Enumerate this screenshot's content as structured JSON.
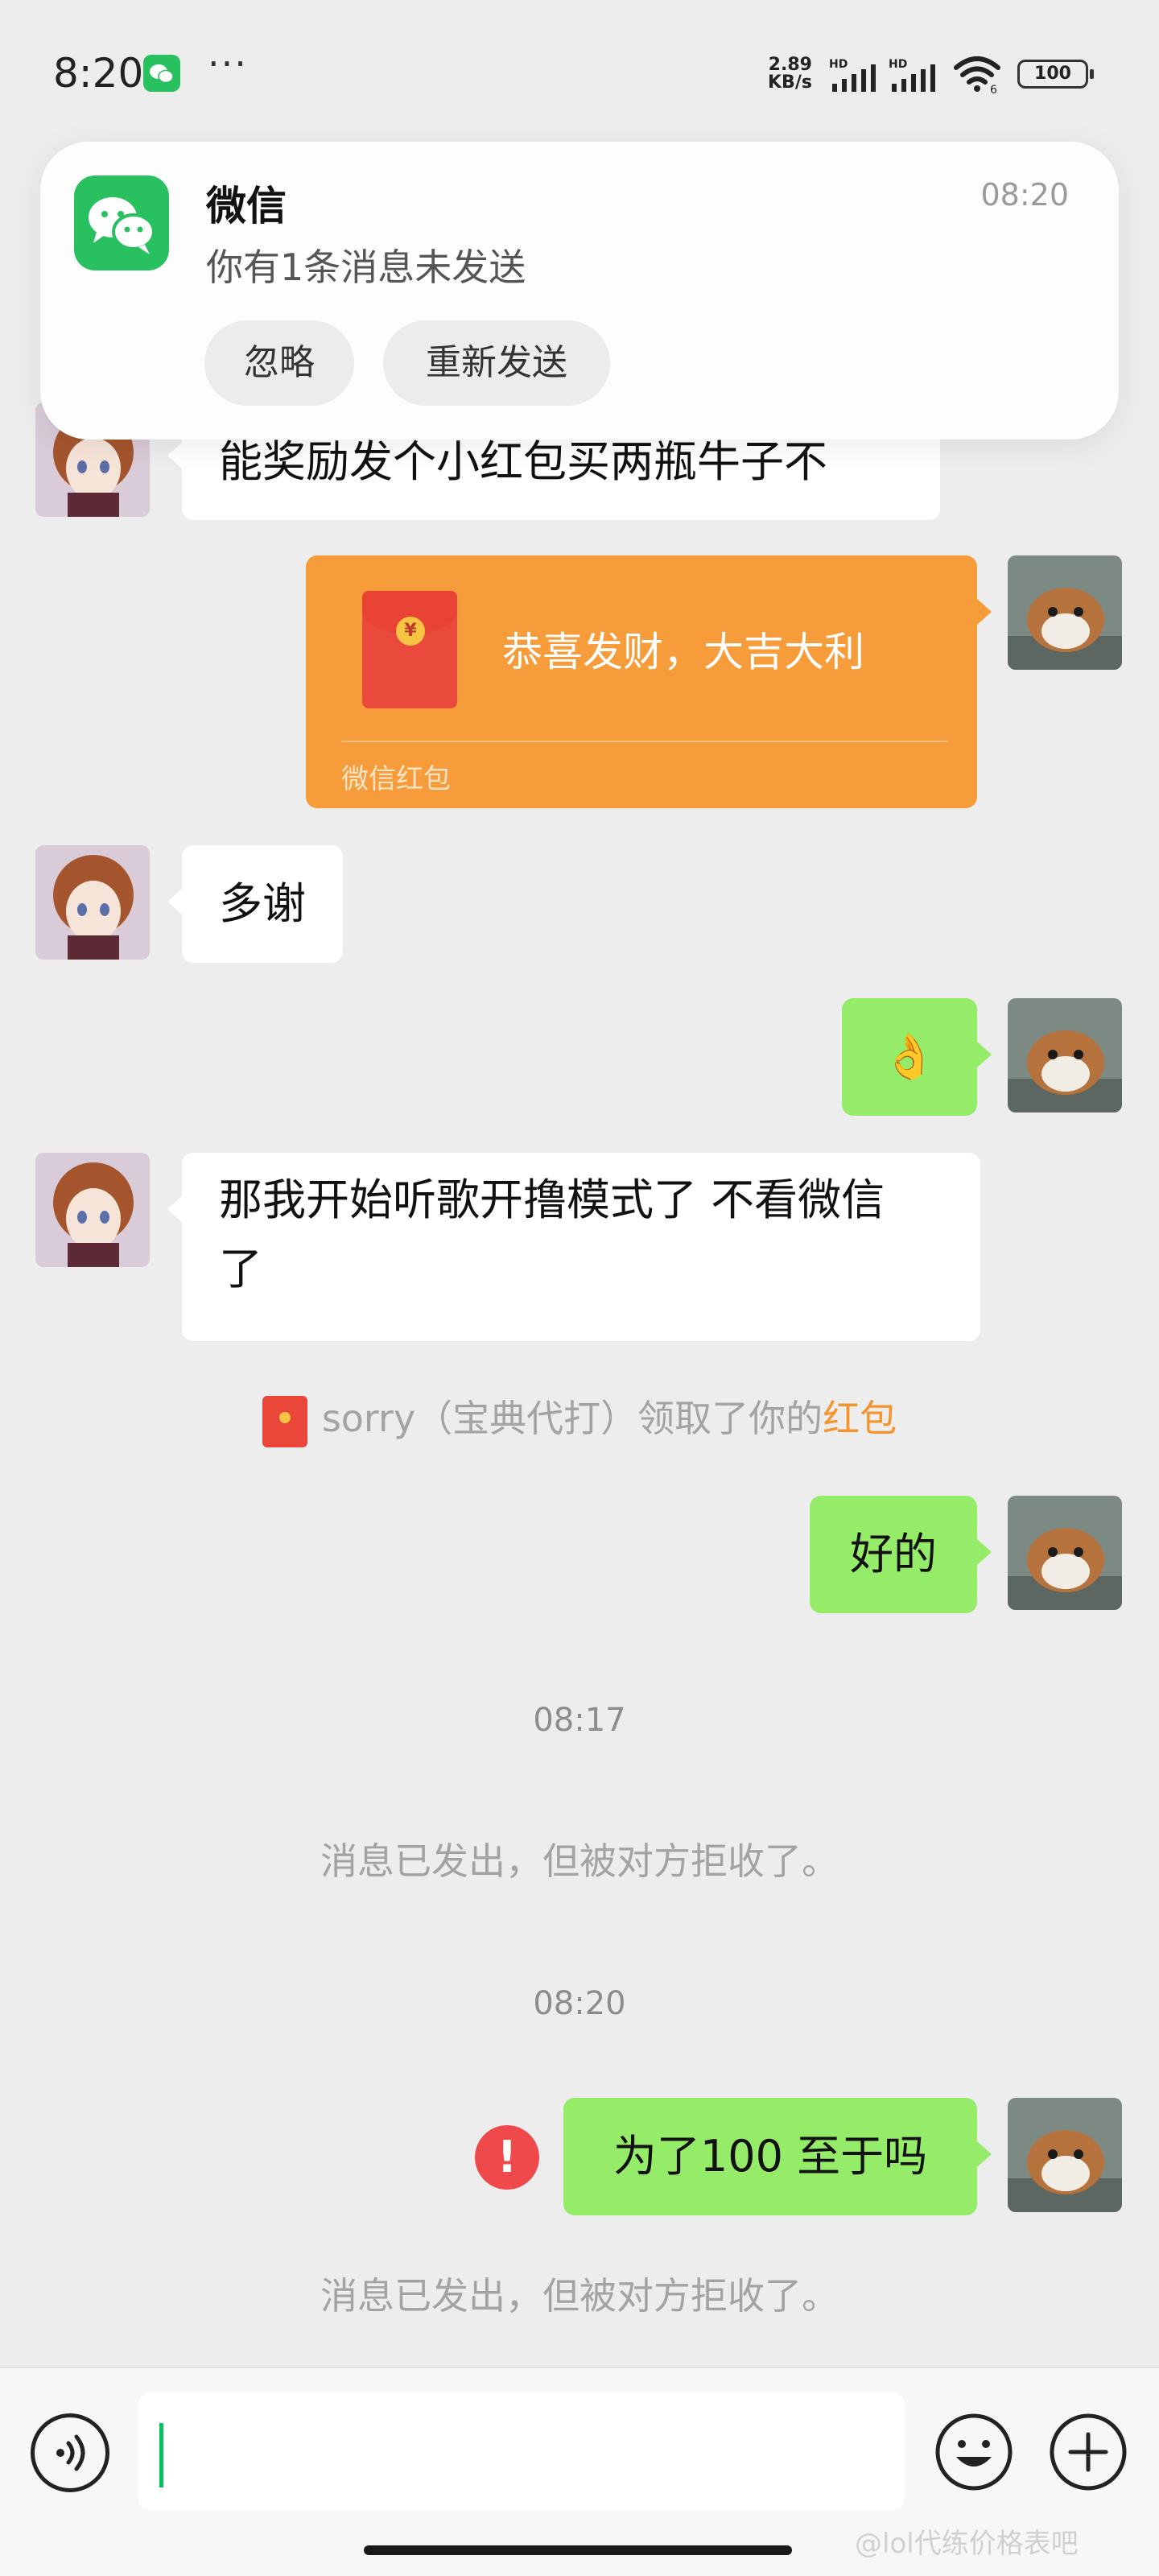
{
  "status_bar": {
    "time": "8:20",
    "more": "···",
    "net_speed_value": "2.89",
    "net_speed_unit": "KB/s",
    "signal_1_label": "HD",
    "signal_2_label": "HD",
    "wifi_badge": "6",
    "battery": "100"
  },
  "notification": {
    "app_name": "微信",
    "time": "08:20",
    "message": "你有1条消息未发送",
    "ignore_label": "忽略",
    "resend_label": "重新发送"
  },
  "messages": {
    "m1_text": "能奖励发个小红包买两瓶牛子不",
    "red_packet_greeting": "恭喜发财，大吉大利",
    "red_packet_footer": "微信红包",
    "red_packet_coin": "¥",
    "m3_text": "多谢",
    "m4_emoji": "👌",
    "m5_line1": "那我开始听歌开撸模式了 不看微信",
    "m5_line2": "了",
    "claim_prefix": "sorry（宝典代打）领取了你的",
    "claim_link": "红包",
    "m6_text": "好的",
    "timestamp_1": "08:17",
    "rejected_1": "消息已发出，但被对方拒收了。",
    "timestamp_2": "08:20",
    "m7_text": "为了100 至于吗",
    "error_mark": "!",
    "rejected_2": "消息已发出，但被对方拒收了。"
  },
  "input_bar": {
    "value": "",
    "watermark": "@lol代练价格表吧"
  },
  "colors": {
    "background": "#ededed",
    "bubble_self": "#95ec69",
    "bubble_other": "#ffffff",
    "red_packet": "#f79c3a",
    "wechat_green": "#29c05f",
    "error_red": "#f0494c"
  }
}
